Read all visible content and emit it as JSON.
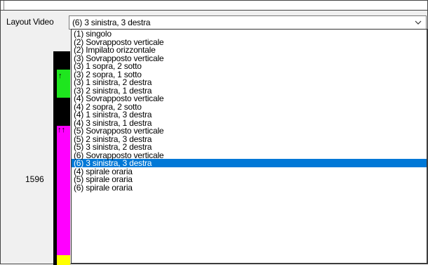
{
  "field": {
    "label": "Layout Video",
    "value": "(6) 3 sinistra, 3 destra"
  },
  "preview": {
    "number": "1596",
    "colors": {
      "green": "#1ee61e",
      "magenta": "#ff00ff",
      "yellow": "#ffff00",
      "selection": "#0078d7"
    }
  },
  "dropdown": {
    "selected_index": 17,
    "options": [
      "(1) singolo",
      "(2) Sovrapposto verticale",
      "(2) Impilato orizzontale",
      "(3) Sovrapposto verticale",
      "(3) 1 sopra, 2 sotto",
      "(3) 2 sopra, 1 sotto",
      "(3) 1 sinistra, 2 destra",
      "(3) 2 sinistra, 1 destra",
      "(4) Sovrapposto verticale",
      "(4) 2 sopra, 2 sotto",
      "(4) 1 sinistra, 3 destra",
      "(4) 3 sinistra, 1 destra",
      "(5) Sovrapposto verticale",
      "(5) 2 sinistra, 3 destra",
      "(5) 3 sinistra, 2 destra",
      "(6) Sovrapposto verticale",
      "(6) 3 sinistra, 3 destra",
      "(4) spirale oraria",
      "(5) spirale oraria",
      "(6) spirale oraria"
    ]
  }
}
